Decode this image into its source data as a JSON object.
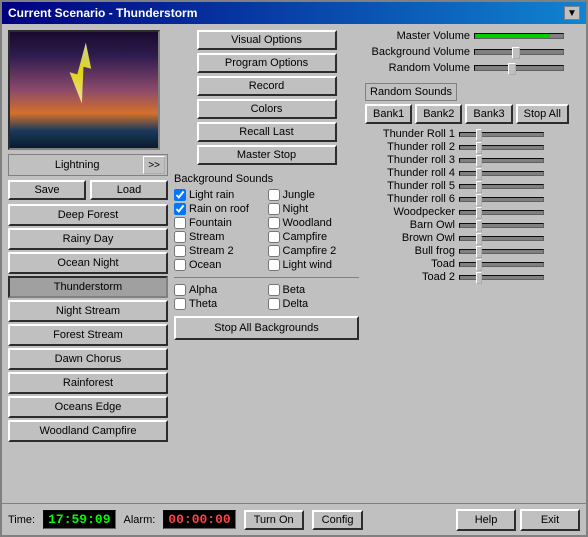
{
  "window": {
    "title": "Current Scenario - Thunderstorm",
    "minimize_label": "▼"
  },
  "preview": {
    "label": "Lightning",
    "nav_label": ">>"
  },
  "save_load": {
    "save_label": "Save",
    "load_label": "Load"
  },
  "scenarios": [
    "Deep Forest",
    "Rainy Day",
    "Ocean Night",
    "Thunderstorm",
    "Night Stream",
    "Forest Stream",
    "Dawn Chorus",
    "Rainforest",
    "Oceans Edge",
    "Woodland Campfire"
  ],
  "options_buttons": {
    "visual": "Visual Options",
    "program": "Program Options",
    "record": "Record",
    "colors": "Colors",
    "recall": "Recall Last",
    "master_stop": "Master Stop"
  },
  "background_sounds": {
    "label": "Background Sounds",
    "items": [
      {
        "label": "Light rain",
        "checked": true,
        "col": 1
      },
      {
        "label": "Jungle",
        "checked": false,
        "col": 2
      },
      {
        "label": "Rain on roof",
        "checked": true,
        "col": 1
      },
      {
        "label": "Night",
        "checked": false,
        "col": 2
      },
      {
        "label": "Fountain",
        "checked": false,
        "col": 1
      },
      {
        "label": "Woodland",
        "checked": false,
        "col": 2
      },
      {
        "label": "Stream",
        "checked": false,
        "col": 1
      },
      {
        "label": "Campfire",
        "checked": false,
        "col": 2
      },
      {
        "label": "Stream 2",
        "checked": false,
        "col": 1
      },
      {
        "label": "Campfire 2",
        "checked": false,
        "col": 2
      },
      {
        "label": "Ocean",
        "checked": false,
        "col": 1
      },
      {
        "label": "Light wind",
        "checked": false,
        "col": 2
      }
    ],
    "waves": [
      {
        "label": "Alpha",
        "checked": false
      },
      {
        "label": "Beta",
        "checked": false
      },
      {
        "label": "Theta",
        "checked": false
      },
      {
        "label": "Delta",
        "checked": false
      }
    ],
    "stop_all": "Stop All Backgrounds"
  },
  "volume": {
    "master_label": "Master Volume",
    "background_label": "Background Volume",
    "random_label": "Random Volume",
    "master_pct": 90,
    "background_pct": 50,
    "random_pct": 45
  },
  "random_sounds": {
    "label": "Random Sounds",
    "banks": [
      "Bank1",
      "Bank2",
      "Bank3",
      "Stop All"
    ],
    "sounds": [
      {
        "name": "Thunder Roll 1",
        "pct": 20
      },
      {
        "name": "Thunder roll 2",
        "pct": 20
      },
      {
        "name": "Thunder roll 3",
        "pct": 20
      },
      {
        "name": "Thunder roll 4",
        "pct": 20
      },
      {
        "name": "Thunder roll 5",
        "pct": 20
      },
      {
        "name": "Thunder roll 6",
        "pct": 20
      },
      {
        "name": "Woodpecker",
        "pct": 20
      },
      {
        "name": "Barn Owl",
        "pct": 20
      },
      {
        "name": "Brown Owl",
        "pct": 20
      },
      {
        "name": "Bull frog",
        "pct": 20
      },
      {
        "name": "Toad",
        "pct": 20
      },
      {
        "name": "Toad 2",
        "pct": 20
      }
    ]
  },
  "bottom": {
    "time_label": "Time:",
    "time_value": "17:59:09",
    "alarm_label": "Alarm:",
    "alarm_value": "00:00:00",
    "turn_on": "Turn On",
    "config": "Config",
    "help": "Help",
    "exit": "Exit"
  }
}
